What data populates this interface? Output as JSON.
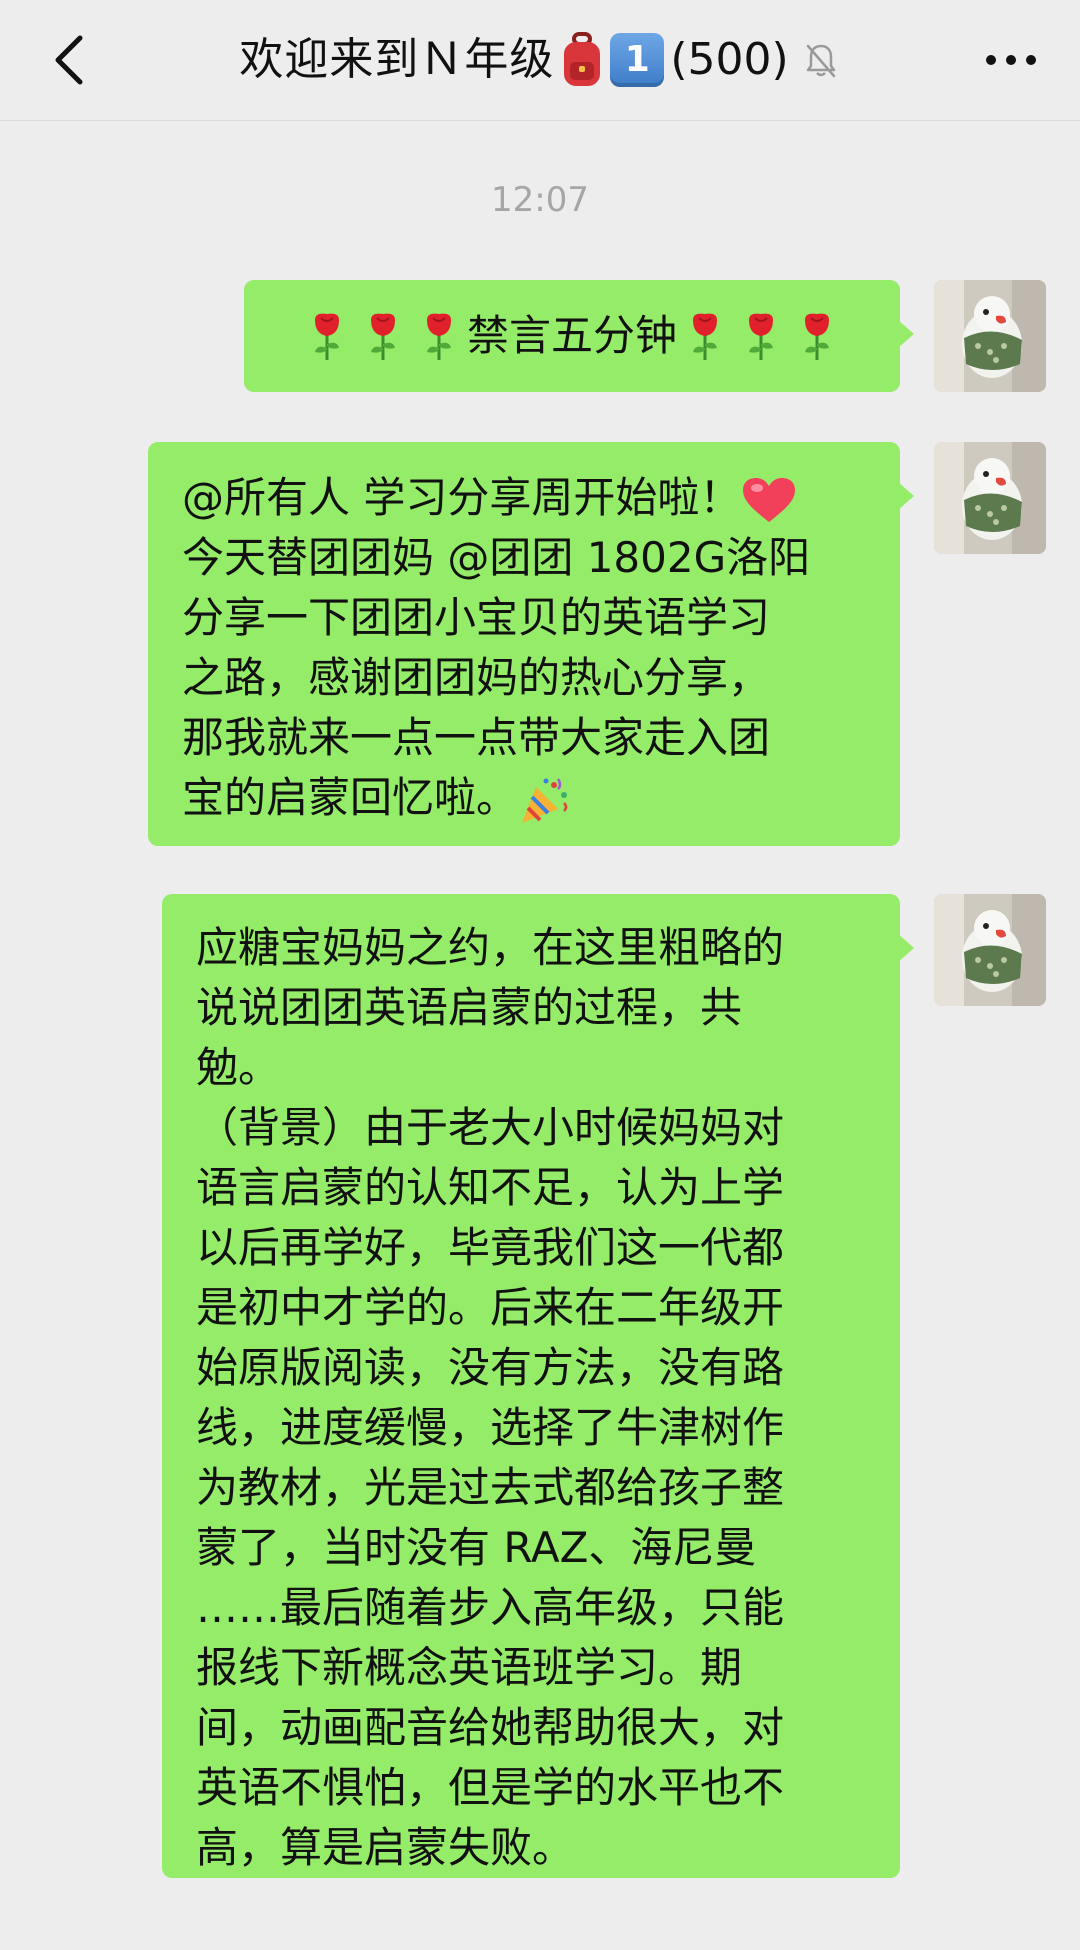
{
  "header": {
    "title": "欢迎来到Ｎ年级",
    "keycap_number": "1",
    "member_count": "(500)",
    "back_icon": "chevron-left-icon",
    "mute_icon": "bell-slash-icon",
    "more_icon": "more-dots-icon"
  },
  "timestamp": "12:07",
  "messages": [
    {
      "sender": "self",
      "text_center": "禁言五分钟",
      "left_emoji": "rose x3",
      "right_emoji": "rose x3"
    },
    {
      "sender": "self",
      "lines": [
        "@所有人 学习分享周开始啦！",
        "今天替团团妈 @团团 1802G洛阳",
        " 分享一下团团小宝贝的英语学习",
        "之路，感谢团团妈的热心分享，",
        "那我就来一点一点带大家走入团",
        "宝的启蒙回忆啦。"
      ],
      "trailing_emoji": [
        "heart",
        "party-popper"
      ]
    },
    {
      "sender": "self",
      "lines": [
        "应糖宝妈妈之约，在这里粗略的",
        "说说团团英语启蒙的过程，共",
        "勉。",
        "（背景）由于老大小时候妈妈对",
        "语言启蒙的认知不足，认为上学",
        "以后再学好，毕竟我们这一代都",
        "是初中才学的。后来在二年级开",
        "始原版阅读，没有方法，没有路",
        "线，进度缓慢，选择了牛津树作",
        "为教材，光是过去式都给孩子整",
        "蒙了，当时没有 RAZ、海尼曼",
        "……最后随着步入高年级，只能",
        "报线下新概念英语班学习。期",
        "间，动画配音给她帮助很大，对",
        "英语不惧怕，但是学的水平也不",
        "高，算是启蒙失败。"
      ]
    }
  ],
  "colors": {
    "background": "#EDEDED",
    "bubble": "#95EC69",
    "timestamp": "#A6A6A6",
    "text": "#111111"
  }
}
